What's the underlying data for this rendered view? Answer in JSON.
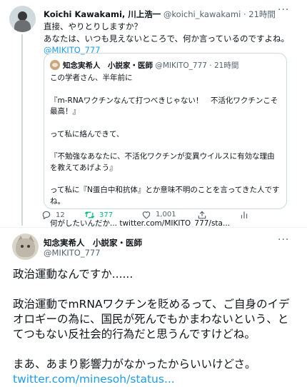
{
  "tweet1": {
    "name": "Koichi Kawakami, 川上浩一",
    "handle": "@koichi_kawakami",
    "time": "· 21時間",
    "lines": [
      "直接、やりとりしますか？",
      "あなたは、いつも見えないところで、何か言っているのですよね。"
    ],
    "mention": "@MIKITO_777",
    "quoted": {
      "name": "知念実希人　小説家・医師",
      "handle": "@MIKITO_777",
      "time": "· 21時間",
      "paragraphs": [
        "この学者さん、半年前に",
        "『m-RNAワクチンなんて打つべきじゃない！　不活化ワクチンこそ最高！』",
        "って私に絡んできて、",
        "『不勉強なあなたに、不活化ワクチンが変異ウイルスに有効な理由を教えてあげよう』",
        "って私に『N蛋白中和抗体』とか意味不明のことを言ってきた人ですね。",
        "何がしたいんだか... twitter.com/MIKITO_777/sta..."
      ]
    },
    "actions": {
      "reply_count": "12",
      "retweet_count": "377",
      "like_count": "1,001"
    },
    "more": "···"
  },
  "tweet2": {
    "name": "知念実希人　小説家・医師",
    "handle": "@MIKITO_777",
    "paragraphs": [
      "政治運動なんですか......",
      "政治運動でmRNAワクチンを貶めるって、ご自身のイデオロギーの為に、国民が死んでもかまわないという、とてつもない反社会的行為だと思うんですけどね。",
      "まあ、あまり影響力がなかったからいいけどさ。"
    ],
    "link": "twitter.com/minesoh/status...",
    "more": "···"
  },
  "colors": {
    "accent": "#1d9bf0",
    "retweet": "#00ba7c",
    "secondary_text": "#536471"
  }
}
